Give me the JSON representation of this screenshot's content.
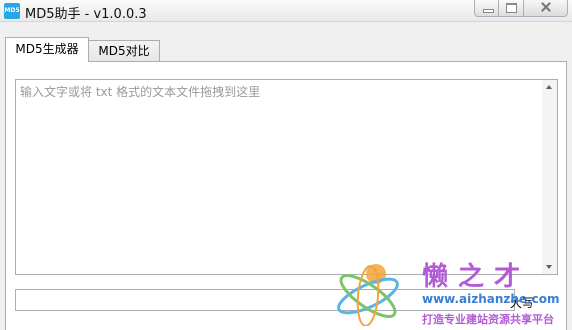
{
  "window": {
    "title": "MD5助手 - v1.0.0.3",
    "icon_text": "MD5",
    "icon_color": "#27a7e6"
  },
  "tabs": [
    {
      "label": "MD5生成器",
      "active": true
    },
    {
      "label": "MD5对比",
      "active": false
    }
  ],
  "generator": {
    "input_placeholder": "输入文字或将 txt 格式的文本文件拖拽到这里",
    "input_value": "",
    "output_value": "",
    "uppercase_label": "大写",
    "uppercase_checked": false
  },
  "watermark": {
    "title": "懒之才",
    "url": "www.aizhanzhe.com",
    "slogan": "打造专业建站资源共享平台",
    "color_primary": "#b25bd6",
    "color_secondary": "#3a7fd0"
  }
}
